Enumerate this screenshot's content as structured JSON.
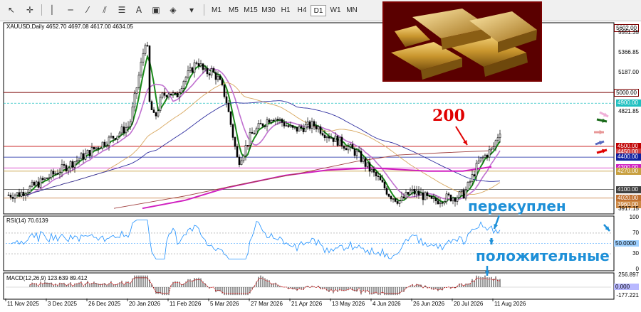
{
  "toolbar": {
    "timeframes": [
      "M1",
      "M5",
      "M15",
      "M30",
      "H1",
      "H4",
      "D1",
      "W1",
      "MN"
    ],
    "active_timeframe": "D1"
  },
  "main_chart": {
    "legend": "XAUUSD,Daily  4652.70 4697.08 4617.00 4634.05",
    "price_ticks": [
      "5602.00",
      "5551.35",
      "5366.85",
      "5187.00",
      "5000.00",
      "4900.00",
      "4821.85",
      "4500.00",
      "4450.00",
      "4400.00",
      "4300.00",
      "4270.00",
      "4100.00",
      "4020.00",
      "3960.00",
      "3917.15"
    ],
    "annotation_200": "200",
    "annotation_overbought": "перекуплен"
  },
  "rsi_pane": {
    "legend": "RSI(14) 70.6139",
    "ticks": [
      "100",
      "70",
      "50.0000",
      "30",
      "0"
    ],
    "annotation_positive": "положительные"
  },
  "macd_pane": {
    "legend": "MACD(12,26,9) 123.639 89.412",
    "ticks": [
      "256.897",
      "0.000",
      "-177.221"
    ]
  },
  "date_ticks": [
    "11 Nov 2025",
    "3 Dec 2025",
    "26 Dec 2025",
    "20 Jan 2026",
    "11 Feb 2026",
    "5 Mar 2026",
    "27 Mar 2026",
    "21 Apr 2026",
    "13 May 2026",
    "4 Jun 2026",
    "26 Jun 2026",
    "20 Jul 2026",
    "11 Aug 2026"
  ],
  "colors": {
    "candle": "#000000",
    "ma_green": "#1a8a1a",
    "ma_violet": "#c070d0",
    "ma_magenta": "#d020c0",
    "ma_navy": "#3030a0",
    "ma_tan": "#d8a860",
    "ma_brown": "#a04040",
    "rsi_line": "#1e90ff",
    "accent_red": "#e00000",
    "accent_blue": "#1e90d8"
  },
  "icons": [
    "cursor-icon",
    "crosshair-icon",
    "vertical-line-icon",
    "horizontal-line-icon",
    "trend-line-icon",
    "channel-icon",
    "fibonacci-icon",
    "text-icon",
    "label-icon",
    "shapes-icon"
  ]
}
